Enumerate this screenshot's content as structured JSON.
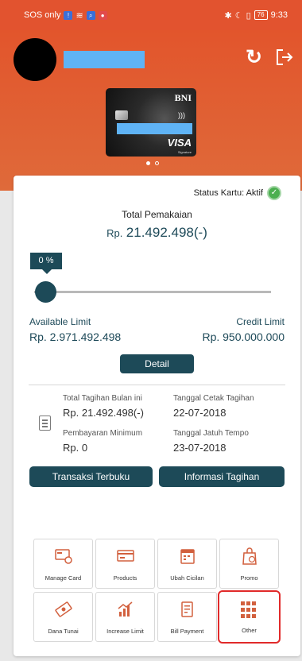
{
  "status_bar": {
    "left_text": "SOS only",
    "battery": "76",
    "time": "9:33"
  },
  "card": {
    "brand": "BNI",
    "network": "VISA",
    "tier": "Signature",
    "slides": 2,
    "active_slide": 1
  },
  "usage": {
    "status_label": "Status Kartu: Aktif",
    "total_label": "Total Pemakaian",
    "currency": "Rp.",
    "total_amount": "21.492.498(-)",
    "percent_label": "0 %",
    "percent_used": 0,
    "available_label": "Available Limit",
    "available_value": "Rp. 2.971.492.498",
    "credit_label": "Credit Limit",
    "credit_value": "Rp. 950.000.000",
    "detail_button": "Detail"
  },
  "bill": {
    "total_label": "Total Tagihan Bulan ini",
    "total_value": "Rp. 21.492.498(-)",
    "print_date_label": "Tanggal Cetak Tagihan",
    "print_date_value": "22-07-2018",
    "min_label": "Pembayaran Minimum",
    "min_value": "Rp. 0",
    "due_date_label": "Tanggal Jatuh Tempo",
    "due_date_value": "23-07-2018"
  },
  "actions": {
    "unbilled_button": "Transaksi Terbuku",
    "bill_info_button": "Informasi Tagihan"
  },
  "menu": [
    {
      "label": "Manage Card",
      "icon": "manage-card-icon"
    },
    {
      "label": "Products",
      "icon": "products-icon"
    },
    {
      "label": "Ubah Cicilan",
      "icon": "calendar-icon"
    },
    {
      "label": "Promo",
      "icon": "shopping-bag-icon"
    },
    {
      "label": "Dana Tunai",
      "icon": "cash-icon"
    },
    {
      "label": "Increase Limit",
      "icon": "growth-chart-icon"
    },
    {
      "label": "Bill Payment",
      "icon": "bill-icon"
    },
    {
      "label": "Other",
      "icon": "grid-icon"
    }
  ],
  "colors": {
    "header": "#e2532f",
    "primary": "#1d4a58",
    "accent": "#d2603e",
    "status_ok": "#4caf50",
    "highlight": "#e12a2a"
  }
}
